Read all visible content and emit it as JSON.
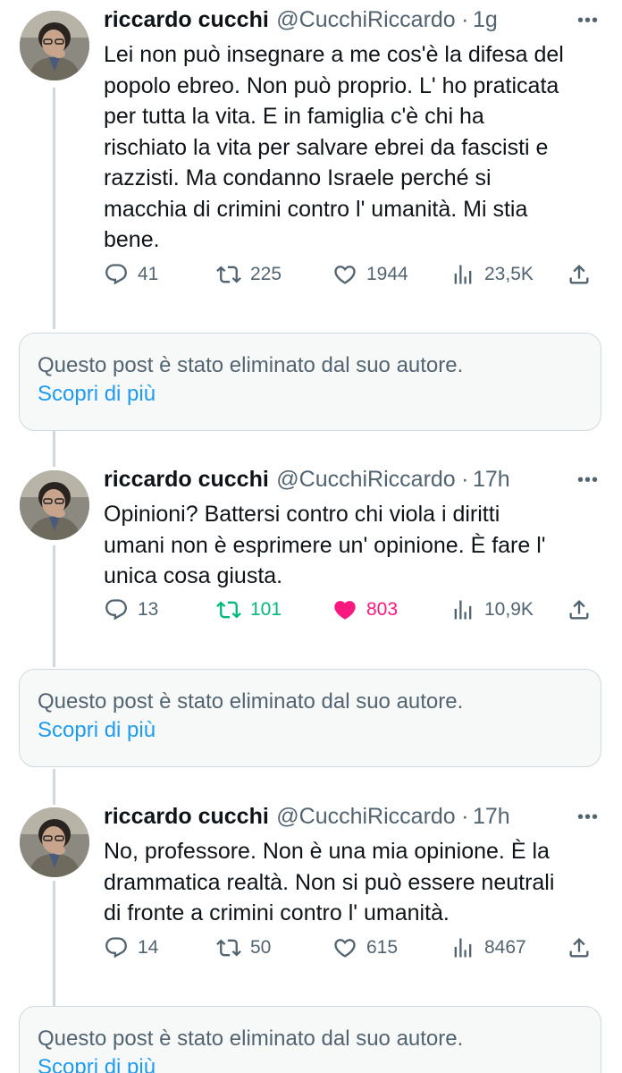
{
  "tweets": [
    {
      "name": "riccardo cucchi",
      "handle": "@CucchiRiccardo",
      "separator": "·",
      "time": "1g",
      "more": "•••",
      "lines": [
        "Lei non può insegnare a me cos'è la difesa del",
        "popolo ebreo. Non può proprio. L' ho praticata",
        "per tutta la vita. E in famiglia c'è chi ha",
        "rischiato la vita per salvare ebrei da fascisti e",
        "razzisti. Ma condanno Israele perché si",
        "macchia di crimini contro l' umanità. Mi stia",
        "bene."
      ],
      "replies": "41",
      "retweets": "225",
      "likes": "1944",
      "views": "23,5K"
    },
    {
      "name": "riccardo cucchi",
      "handle": "@CucchiRiccardo",
      "separator": "·",
      "time": "17h",
      "more": "•••",
      "lines": [
        "Opinioni? Battersi contro chi viola i diritti",
        "umani non è esprimere un' opinione. È fare l'",
        "unica cosa giusta."
      ],
      "replies": "13",
      "retweets": "101",
      "likes": "803",
      "views": "10,9K"
    },
    {
      "name": "riccardo cucchi",
      "handle": "@CucchiRiccardo",
      "separator": "·",
      "time": "17h",
      "more": "•••",
      "lines": [
        "No, professore. Non è una mia opinione. È la",
        "drammatica realtà. Non si può essere neutrali",
        "di fronte a crimini contro l' umanità."
      ],
      "replies": "14",
      "retweets": "50",
      "likes": "615",
      "views": "8467"
    }
  ],
  "deleted_notice": {
    "text": "Questo post è stato eliminato dal suo autore.",
    "link": "Scopri di più"
  },
  "colors": {
    "retweet_active": "#00ba7c",
    "like_active": "#f91880",
    "link": "#1d9bf0",
    "muted": "#536471"
  },
  "icons": [
    "reply-icon",
    "retweet-icon",
    "like-icon",
    "views-icon",
    "share-icon",
    "more-icon"
  ]
}
